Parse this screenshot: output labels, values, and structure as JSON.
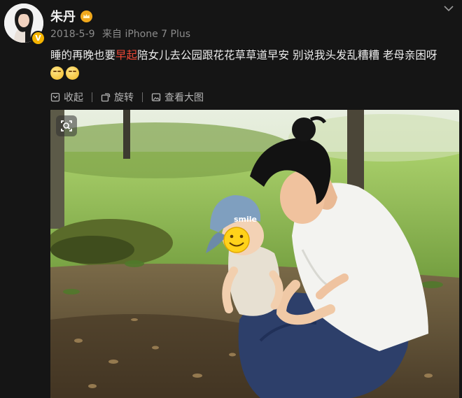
{
  "user": {
    "name": "朱丹",
    "verified_badge": "V",
    "avatar_icon": "avatar-photo",
    "vip_icon": "crown-icon"
  },
  "post": {
    "date": "2018-5-9",
    "source": "来自 iPhone 7 Plus",
    "text_before": "睡的再晚也要",
    "text_highlight": "早起",
    "text_after": "陪女儿去公园跟花花草草道早安  别说我头发乱糟糟 老母亲困呀",
    "emojis": [
      "sleepy-emoji",
      "sleepy-emoji"
    ]
  },
  "actions": {
    "collapse": "收起",
    "rotate": "旋转",
    "view_large": "查看大图"
  },
  "image": {
    "subject": "photo-mother-and-baby-in-park",
    "cap_text": "smile"
  },
  "colors": {
    "background": "#151515",
    "highlight": "#f04836",
    "meta": "#8b8b8b"
  }
}
